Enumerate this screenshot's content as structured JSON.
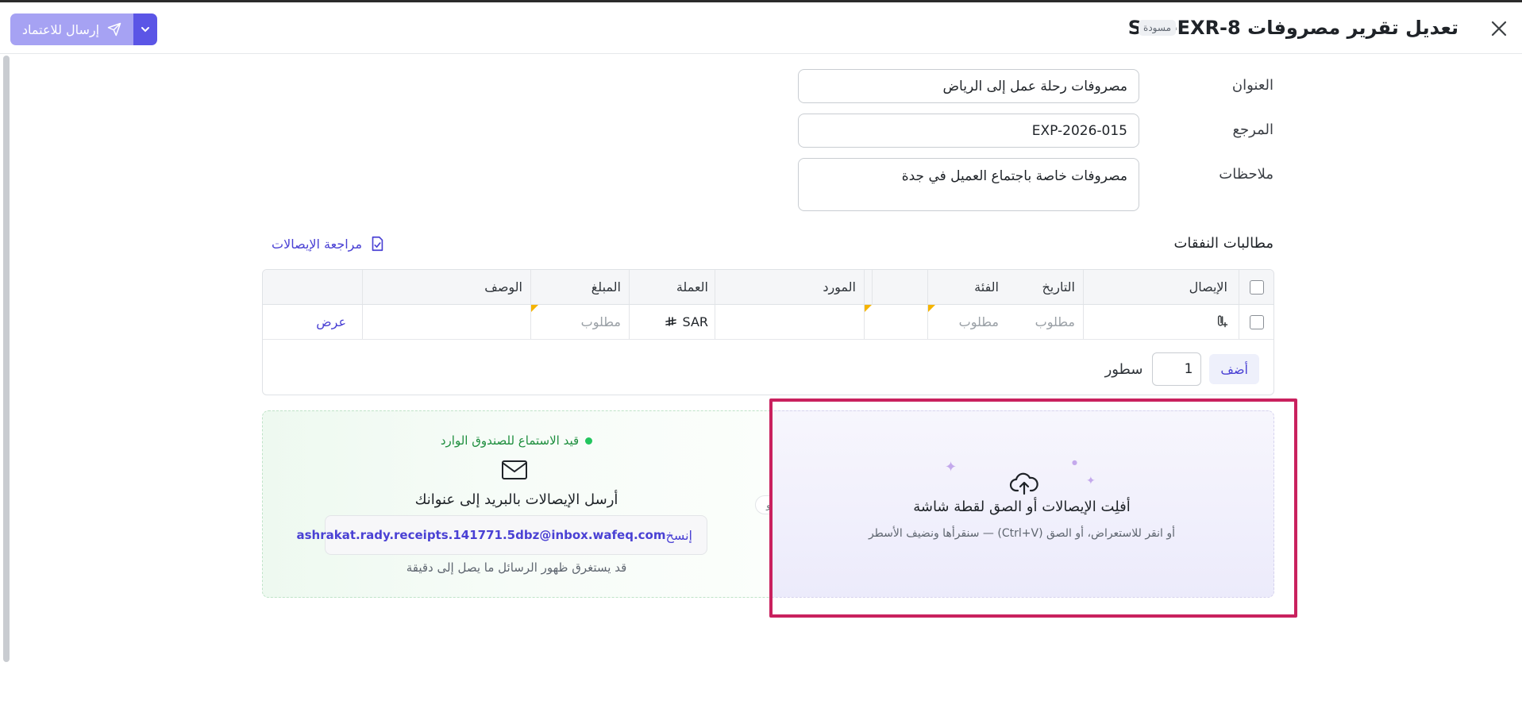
{
  "header": {
    "title": "تعديل تقرير مصروفات SYS-EXR-8",
    "status_badge": "مسودة",
    "send_button_label": "إرسال للاعتماد"
  },
  "form": {
    "title_label": "العنوان",
    "title_value": "مصروفات رحلة عمل إلى الرياض",
    "reference_label": "المرجع",
    "reference_value": "EXP-2026-015",
    "notes_label": "ملاحظات",
    "notes_value": "مصروفات خاصة باجتماع العميل في جدة"
  },
  "claims": {
    "section_title": "مطالبات النفقات",
    "review_link": "مراجعة الإيصالات",
    "columns": {
      "receipt": "الإيصال",
      "date": "التاريخ",
      "category": "الفئة",
      "vendor": "المورد",
      "currency": "العملة",
      "amount": "المبلغ",
      "description": "الوصف"
    },
    "row": {
      "date": "مطلوب",
      "category": "مطلوب",
      "vendor": "",
      "currency": "SAR",
      "amount": "مطلوب",
      "description": "",
      "action": "عرض"
    },
    "add_button": "أضف",
    "rows_count": "1",
    "rows_label": "سطور"
  },
  "email_intake": {
    "status": "قيد الاستماع للصندوق الوارد",
    "title": "أرسل الإيصالات بالبريد إلى عنوانك",
    "address": "ashrakat.rady.receipts.141771.5dbz@inbox.wafeq.com",
    "copy_label": "إنسخ",
    "note": "قد يستغرق ظهور الرسائل ما يصل إلى دقيقة"
  },
  "divider_label": "و",
  "dropzone": {
    "title": "أفلِت الإيصالات أو الصق لقطة شاشة",
    "subtitle": "أو انقر للاستعراض، أو الصق (Ctrl+V) — سنقرأها ونضيف الأسطر"
  },
  "colors": {
    "accent": "#4a41d4",
    "send_button": "#a6a2f3",
    "highlight": "#c9215e",
    "listening_green": "#1e8e3e"
  },
  "icons": {
    "close": "close-icon",
    "send": "paper-plane-icon",
    "caret": "chevron-down-icon",
    "review": "receipt-check-icon",
    "attach": "paperclip-plus-icon",
    "currency": "riyal-symbol-icon",
    "mail": "envelope-icon",
    "upload": "cloud-upload-icon"
  }
}
